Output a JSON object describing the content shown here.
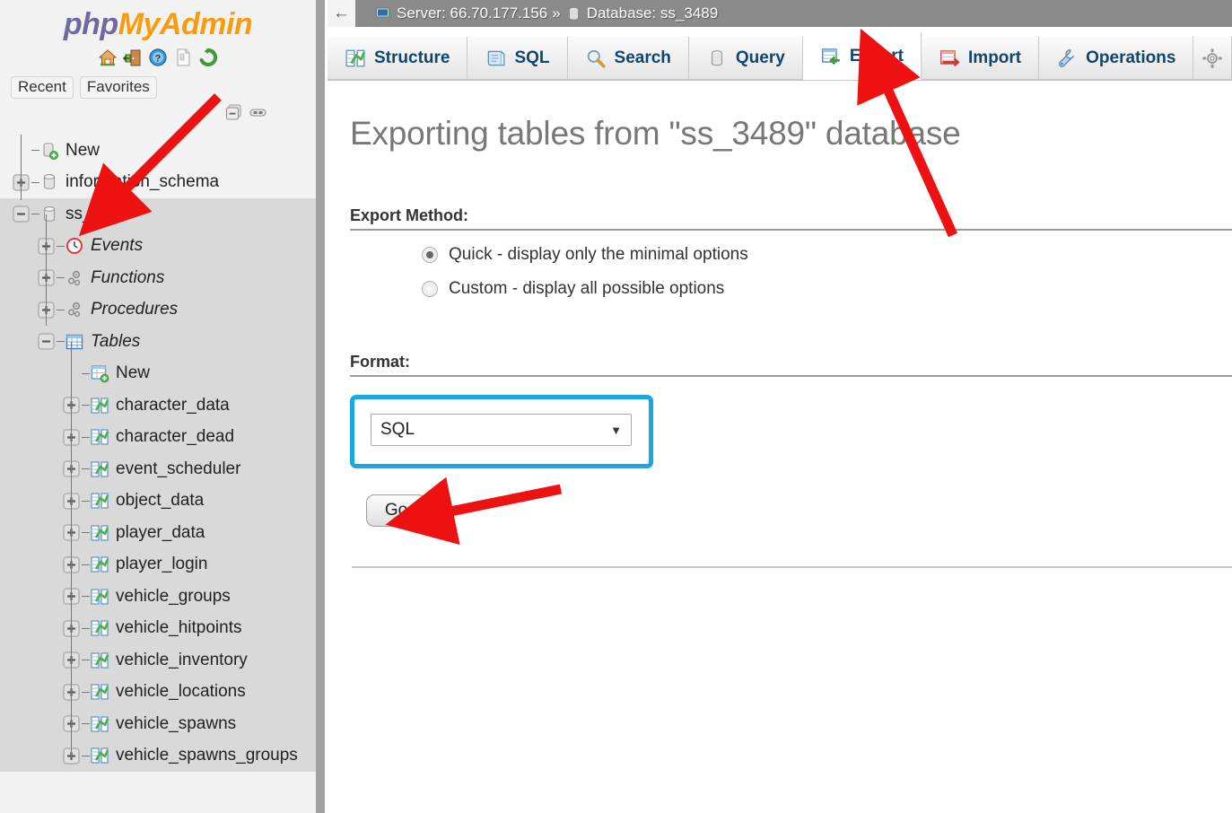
{
  "sidebar": {
    "logo": {
      "part1": "php",
      "part2": "MyAdmin"
    },
    "header_icons": [
      {
        "name": "home-icon",
        "title": "Home"
      },
      {
        "name": "logout-icon",
        "title": "Log out"
      },
      {
        "name": "help-icon",
        "title": "phpMyAdmin documentation"
      },
      {
        "name": "documentation-icon",
        "title": "Documentation"
      },
      {
        "name": "reload-icon",
        "title": "Reload navigation panel"
      }
    ],
    "chips": [
      {
        "label": "Recent"
      },
      {
        "label": "Favorites"
      }
    ],
    "tree_controls": [
      {
        "name": "collapse-all-icon"
      },
      {
        "name": "link-with-main-panel-icon"
      }
    ],
    "tree": [
      {
        "label": "New",
        "icon": "database-new-icon",
        "expander": "none",
        "indent": 1,
        "italic": false,
        "selected": false
      },
      {
        "label": "information_schema",
        "icon": "database-icon",
        "expander": "plus",
        "indent": 1,
        "italic": false,
        "selected": false
      },
      {
        "label": "ss_3489",
        "icon": "database-icon",
        "expander": "minus",
        "indent": 1,
        "italic": false,
        "selected": true
      },
      {
        "label": "Events",
        "icon": "events-icon",
        "expander": "plus",
        "indent": 2,
        "italic": true,
        "selected": false
      },
      {
        "label": "Functions",
        "icon": "functions-icon",
        "expander": "plus",
        "indent": 2,
        "italic": true,
        "selected": false
      },
      {
        "label": "Procedures",
        "icon": "procedures-icon",
        "expander": "plus",
        "indent": 2,
        "italic": true,
        "selected": false
      },
      {
        "label": "Tables",
        "icon": "tables-icon",
        "expander": "minus",
        "indent": 2,
        "italic": true,
        "selected": false
      },
      {
        "label": "New",
        "icon": "table-new-icon",
        "expander": "none",
        "indent": 3,
        "italic": false,
        "selected": false
      },
      {
        "label": "character_data",
        "icon": "table-icon",
        "expander": "plus",
        "indent": 3,
        "italic": false,
        "selected": false
      },
      {
        "label": "character_dead",
        "icon": "table-icon",
        "expander": "plus",
        "indent": 3,
        "italic": false,
        "selected": false
      },
      {
        "label": "event_scheduler",
        "icon": "table-icon",
        "expander": "plus",
        "indent": 3,
        "italic": false,
        "selected": false
      },
      {
        "label": "object_data",
        "icon": "table-icon",
        "expander": "plus",
        "indent": 3,
        "italic": false,
        "selected": false
      },
      {
        "label": "player_data",
        "icon": "table-icon",
        "expander": "plus",
        "indent": 3,
        "italic": false,
        "selected": false
      },
      {
        "label": "player_login",
        "icon": "table-icon",
        "expander": "plus",
        "indent": 3,
        "italic": false,
        "selected": false
      },
      {
        "label": "vehicle_groups",
        "icon": "table-icon",
        "expander": "plus",
        "indent": 3,
        "italic": false,
        "selected": false
      },
      {
        "label": "vehicle_hitpoints",
        "icon": "table-icon",
        "expander": "plus",
        "indent": 3,
        "italic": false,
        "selected": false
      },
      {
        "label": "vehicle_inventory",
        "icon": "table-icon",
        "expander": "plus",
        "indent": 3,
        "italic": false,
        "selected": false
      },
      {
        "label": "vehicle_locations",
        "icon": "table-icon",
        "expander": "plus",
        "indent": 3,
        "italic": false,
        "selected": false
      },
      {
        "label": "vehicle_spawns",
        "icon": "table-icon",
        "expander": "plus",
        "indent": 3,
        "italic": false,
        "selected": false
      },
      {
        "label": "vehicle_spawns_groups",
        "icon": "table-icon",
        "expander": "plus",
        "indent": 3,
        "italic": false,
        "selected": false
      }
    ]
  },
  "breadcrumb": {
    "back_arrow": "←",
    "server_label": "Server: 66.70.177.156",
    "separator": "»",
    "database_label": "Database: ss_3489"
  },
  "tabs": [
    {
      "label": "Structure",
      "icon": "structure-icon",
      "active": false
    },
    {
      "label": "SQL",
      "icon": "sql-icon",
      "active": false
    },
    {
      "label": "Search",
      "icon": "search-icon",
      "active": false
    },
    {
      "label": "Query",
      "icon": "query-icon",
      "active": false
    },
    {
      "label": "Export",
      "icon": "export-icon",
      "active": true
    },
    {
      "label": "Import",
      "icon": "import-icon",
      "active": false
    },
    {
      "label": "Operations",
      "icon": "operations-icon",
      "active": false
    },
    {
      "label": "",
      "icon": "settings-gear-icon",
      "active": false
    }
  ],
  "main": {
    "page_title": "Exporting tables from \"ss_3489\" database",
    "export_method": {
      "heading": "Export Method:",
      "options": [
        {
          "label": "Quick - display only the minimal options",
          "selected": true
        },
        {
          "label": "Custom - display all possible options",
          "selected": false
        }
      ]
    },
    "format": {
      "heading": "Format:",
      "selected_value": "SQL",
      "caret": "▼"
    },
    "go_button": {
      "label": "Go"
    }
  },
  "colors": {
    "highlight_box": "#1aa7e0",
    "annotation_arrow": "#ee1111",
    "breadcrumb_bg": "#8a8a8a",
    "tab_text": "#12456d",
    "logo_php": "#6c6a9e",
    "logo_my": "#f89c0e"
  }
}
